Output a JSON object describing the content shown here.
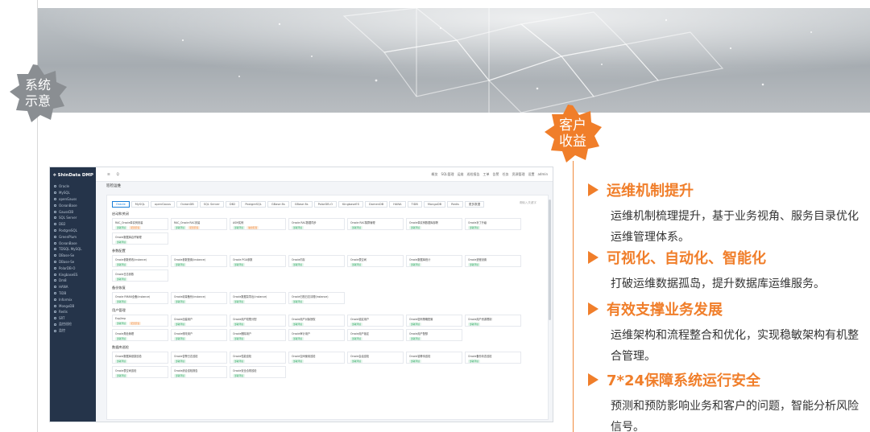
{
  "badges": {
    "left": "系统\n示意",
    "right": "客户\n收益"
  },
  "app": {
    "logo": "ShinData DMP",
    "sidebar_items": [
      "Oracle",
      "MySQL",
      "openGauss",
      "OceanBase",
      "GaussDB",
      "SQL Server",
      "DB2",
      "PostgreSQL",
      "GreenPlum",
      "OceanBase",
      "TDSQL MySQL",
      "DBase-Se",
      "DBase-Se",
      "PolarDB-O",
      "KingbaseES",
      "Dm8",
      "HANA",
      "TiDB",
      "Informix",
      "MongoDB",
      "Redis",
      "SRT",
      "监控巡检",
      "监控"
    ],
    "header_search_icon": "Q",
    "header_links": [
      "概览",
      "SQL管理",
      "运维",
      "巡检报告",
      "工单",
      "告警",
      "任务",
      "资源管理",
      "设置",
      "admin"
    ],
    "breadcrumb": "巡检运维",
    "tabs": [
      "Oracle",
      "MySQL",
      "openGauss",
      "OceanDB",
      "SQL Server",
      "DB2",
      "PostgreSQL",
      "GBase 8s",
      "GBase 8s",
      "PolarDB-O",
      "KingbaseES",
      "DamenDB",
      "HANA",
      "TiDB",
      "MongoDB",
      "Redis",
      "更多数据"
    ],
    "search_placeholder": "请输入关键字",
    "sections": [
      {
        "title": "启动和关闭",
        "cards": [
          [
            "RAC_Oracle单实例安装",
            "部署环境",
            "配置安装"
          ],
          [
            "RAC_Oracle RAC安装",
            "部署环境",
            "配置安装"
          ],
          [
            "ASM实例",
            "部署环境",
            "磁盘配置"
          ],
          [
            "Oracle RAC数据同步",
            "部署环境"
          ],
          [
            "Oracle RAC集群管理",
            "部署环境"
          ],
          [
            "Oracle单实例数据库部署",
            "部署环境"
          ],
          [
            "Oracle补丁升级",
            "部署环境"
          ],
          [
            "Oracle数据库启停管理",
            "部署环境"
          ]
        ]
      },
      {
        "title": "参数配置",
        "cards": [
          [
            "Oracle参数修改(instance)",
            "部署环境"
          ],
          [
            "Oracle参数配置(instance)",
            "部署环境"
          ],
          [
            "Oracle PGA参数",
            "部署环境"
          ],
          [
            "Oracle内存",
            "部署环境"
          ],
          [
            "Oracle表空间",
            "部署环境"
          ],
          [
            "Oracle数据库统计",
            "部署环境"
          ],
          [
            "Oracle进程设置",
            "部署环境"
          ],
          [
            "Oracle日志参数",
            "部署环境"
          ]
        ]
      },
      {
        "title": "备份恢复",
        "cards": [
          [
            "Oracle RMAN全备(instance)",
            "部署环境"
          ],
          [
            "Oracle增量备份(instance)",
            "部署环境"
          ],
          [
            "Oracle数据泵导出(instance)",
            "部署环境"
          ],
          [
            "Oracle归档日志清理(instance)",
            "部署环境"
          ]
        ]
      },
      {
        "title": "用户管理",
        "cards": [
          [
            "Exp/Imp",
            "部署环境",
            "配置安装"
          ],
          [
            "Oracle创建用户",
            "部署环境"
          ],
          [
            "Oracle用户权限分配",
            "部署环境"
          ],
          [
            "Oracle用户对象授权",
            "部署环境"
          ],
          [
            "Oracle锁定用户",
            "部署环境"
          ],
          [
            "Oracle密码策略配置",
            "部署环境"
          ],
          [
            "Oracle用户资源限制",
            "部署环境"
          ],
          [
            "Oracle角色管理",
            "部署环境"
          ],
          [
            "Oracle修改用户",
            "部署环境"
          ],
          [
            "Oracle删除用户",
            "部署环境"
          ],
          [
            "Oracle审计用户",
            "部署环境"
          ],
          [
            "Oracle用户锁定",
            "部署环境"
          ],
          [
            "Oracle用户配额",
            "部署环境"
          ]
        ]
      },
      {
        "title": "数据库巡检",
        "cards": [
          [
            "Oracle数据库健康巡检",
            "部署环境"
          ],
          [
            "Oracle告警日志巡检",
            "部署环境"
          ],
          [
            "Oracle性能巡检",
            "部署环境"
          ],
          [
            "Oracle空间使用巡检",
            "部署环境"
          ],
          [
            "Oracle会话巡检",
            "部署环境"
          ],
          [
            "Oracle锁等待巡检",
            "部署环境"
          ],
          [
            "Oracle备份状态巡检",
            "部署环境"
          ],
          [
            "Oracle表空间巡检",
            "部署环境"
          ],
          [
            "Oracle综合巡检报告",
            "部署环境"
          ],
          [
            "Oracle安全合规巡检",
            "部署环境"
          ]
        ]
      }
    ]
  },
  "benefits": [
    {
      "title": "运维机制提升",
      "body": "运维机制梳理提升，基于业务视角、服务目录优化运维管理体系。"
    },
    {
      "title": "可视化、自动化、智能化",
      "body": "打破运维数据孤岛，提升数据库运维服务。"
    },
    {
      "title": "有效支撑业务发展",
      "body": "运维架构和流程整合和优化，实现稳敏架构有机整合管理。"
    },
    {
      "title": "7*24保障系统运行安全",
      "body": "预测和预防影响业务和客户的问题，智能分析风险信号。"
    }
  ]
}
